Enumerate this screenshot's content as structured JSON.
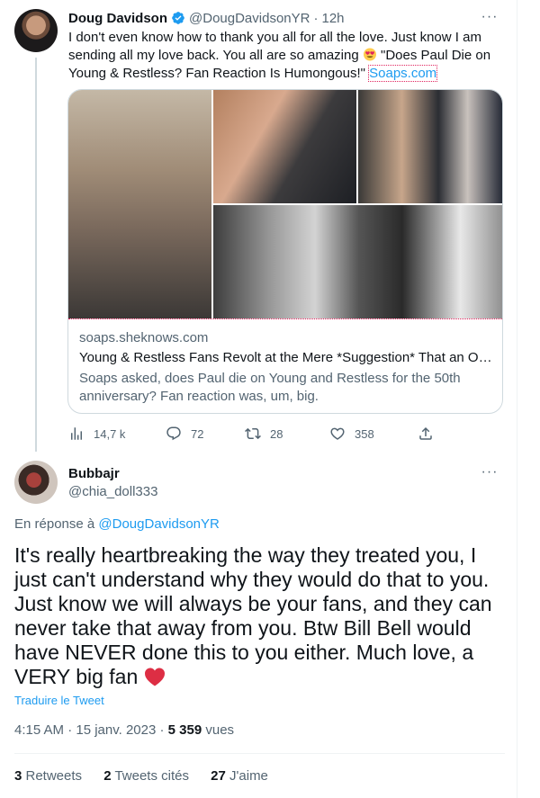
{
  "parent_tweet": {
    "author_name": "Doug Davidson",
    "handle": "@DougDavidsonYR",
    "separator": "·",
    "time": "12h",
    "more": "···",
    "text_before": "I don't even know how to thank you all for all the love. Just know I am sending all my love back. You all are so amazing ",
    "text_after": " \"Does Paul Die on Young & Restless? Fan Reaction Is Humongous!\" ",
    "link_text": "Soaps.com",
    "card": {
      "domain": "soaps.sheknows.com",
      "title": "Young & Restless Fans Revolt at the Mere *Suggestion* That an Off-Ca...",
      "description": "Soaps asked, does Paul die on Young and Restless for the 50th anniversary? Fan reaction was, um, big."
    },
    "actions": {
      "views": "14,7 k",
      "replies": "72",
      "retweets": "28",
      "likes": "358"
    },
    "icons": {
      "verified": "verified-badge-icon",
      "views": "analytics-icon",
      "reply": "reply-icon",
      "retweet": "retweet-icon",
      "like": "heart-icon",
      "share": "share-icon"
    },
    "colors": {
      "accent": "#1d9bf0",
      "muted": "#536471"
    }
  },
  "reply_tweet": {
    "author_name": "Bubbajr",
    "handle": "@chia_doll333",
    "more": "···",
    "replying_prefix": "En réponse à ",
    "replying_to": "@DougDavidsonYR",
    "text": "It's really heartbreaking the way they treated you, I just can't understand why they would do that to you. Just know we will always be your fans, and they can never take that away from you.  Btw Bill Bell would have NEVER  done this to you either.  Much love, a VERY big fan ",
    "translate": "Traduire le Tweet",
    "time": "4:15 AM · 15 janv. 2023 · ",
    "views_count": "5 359",
    "views_label": " vues",
    "stats": {
      "retweets_count": "3",
      "retweets_label": " Retweets",
      "quotes_count": "2",
      "quotes_label": " Tweets cités",
      "likes_count": "27",
      "likes_label": " J'aime"
    }
  }
}
